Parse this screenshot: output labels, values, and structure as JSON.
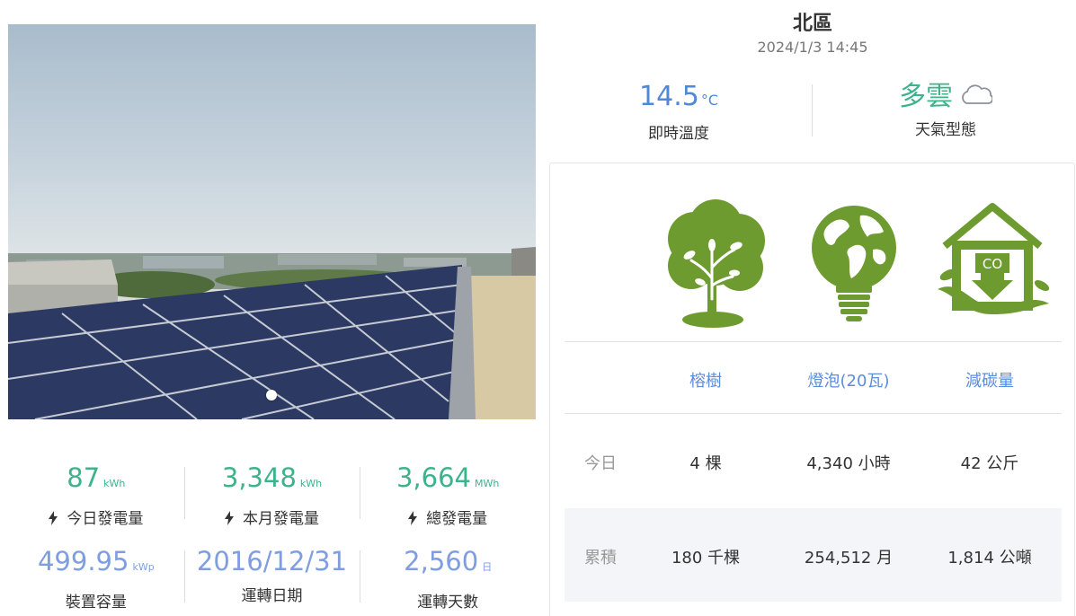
{
  "site": {
    "name": "北區",
    "datetime": "2024/1/3 14:45"
  },
  "weather": {
    "temperature": "14.5",
    "temperature_unit": "°C",
    "temperature_label": "即時溫度",
    "condition": "多雲",
    "condition_icon": "cloud-icon",
    "condition_label": "天氣型態"
  },
  "generation": [
    {
      "value": "87",
      "unit": "kWh",
      "label": "今日發電量",
      "icon": "lightning-icon"
    },
    {
      "value": "3,348",
      "unit": "kWh",
      "label": "本月發電量",
      "icon": "lightning-icon"
    },
    {
      "value": "3,664",
      "unit": "MWh",
      "label": "總發電量",
      "icon": "lightning-icon"
    }
  ],
  "system": [
    {
      "value": "499.95",
      "unit": "kWp",
      "label": "裝置容量"
    },
    {
      "value": "2016/12/31",
      "unit": "",
      "label": "運轉日期"
    },
    {
      "value": "2,560",
      "unit": "日",
      "label": "運轉天數"
    }
  ],
  "benefits": {
    "icons": [
      "tree-icon",
      "globe-bulb-icon",
      "co2-house-icon"
    ],
    "columns": [
      "榕樹",
      "燈泡(20瓦)",
      "減碳量"
    ],
    "rows": [
      {
        "label": "今日",
        "values": [
          "4 棵",
          "4,340 小時",
          "42 公斤"
        ]
      },
      {
        "label": "累積",
        "values": [
          "180 千棵",
          "254,512 月",
          "1,814 公噸"
        ]
      }
    ]
  },
  "colors": {
    "green": "#3cb38a",
    "blue": "#7e9ee0",
    "icon_green": "#6e9b2f",
    "header_blue": "#5b8dd8"
  }
}
